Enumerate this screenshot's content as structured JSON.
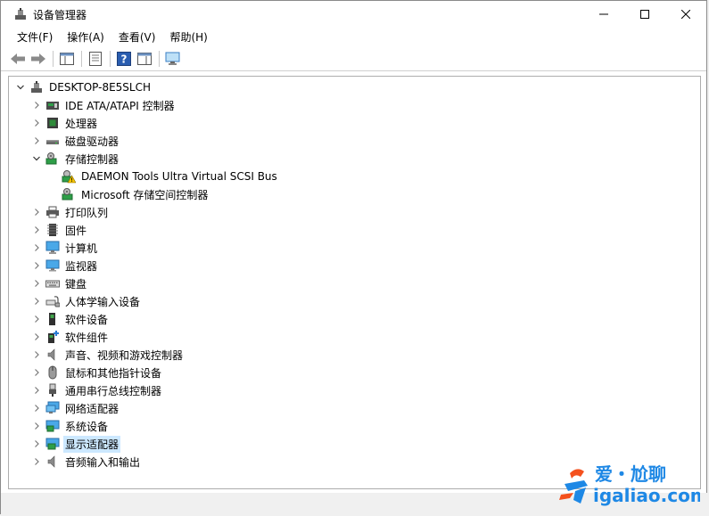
{
  "window": {
    "title": "设备管理器",
    "minimize_label": "",
    "maximize_label": "",
    "close_label": ""
  },
  "menu": [
    {
      "label": "文件(F)"
    },
    {
      "label": "操作(A)"
    },
    {
      "label": "查看(V)"
    },
    {
      "label": "帮助(H)"
    }
  ],
  "toolbar": {
    "buttons": [
      "back-arrow-icon",
      "forward-arrow-icon",
      "show-hide-tree-icon",
      "properties-icon",
      "help-icon",
      "action-pane-icon",
      "monitor-scan-icon"
    ]
  },
  "tree": {
    "root": "DESKTOP-8E5SLCH",
    "items": [
      {
        "label": "IDE ATA/ATAPI 控制器",
        "icon": "ide-controller-icon"
      },
      {
        "label": "处理器",
        "icon": "processor-icon"
      },
      {
        "label": "磁盘驱动器",
        "icon": "disk-drive-icon"
      },
      {
        "label": "存储控制器",
        "icon": "storage-controller-icon",
        "expanded": true
      },
      {
        "label": "DAEMON Tools Ultra Virtual SCSI Bus",
        "icon": "warning-storage-icon",
        "child": true
      },
      {
        "label": "Microsoft 存储空间控制器",
        "icon": "storage-controller-icon",
        "child": true
      },
      {
        "label": "打印队列",
        "icon": "printer-icon"
      },
      {
        "label": "固件",
        "icon": "firmware-icon"
      },
      {
        "label": "计算机",
        "icon": "computer-icon"
      },
      {
        "label": "监视器",
        "icon": "monitor-icon"
      },
      {
        "label": "键盘",
        "icon": "keyboard-icon"
      },
      {
        "label": "人体学输入设备",
        "icon": "hid-icon"
      },
      {
        "label": "软件设备",
        "icon": "software-device-icon"
      },
      {
        "label": "软件组件",
        "icon": "software-component-icon"
      },
      {
        "label": "声音、视频和游戏控制器",
        "icon": "speaker-icon"
      },
      {
        "label": "鼠标和其他指针设备",
        "icon": "mouse-icon"
      },
      {
        "label": "通用串行总线控制器",
        "icon": "usb-icon"
      },
      {
        "label": "网络适配器",
        "icon": "network-adapter-icon"
      },
      {
        "label": "系统设备",
        "icon": "system-device-icon"
      },
      {
        "label": "显示适配器",
        "icon": "display-adapter-icon",
        "selected": true
      },
      {
        "label": "音频输入和输出",
        "icon": "audio-io-icon"
      }
    ]
  },
  "watermark": {
    "brand": "爱・尬聊",
    "url": "igaliao.com"
  },
  "colors": {
    "selection": "#cce8ff",
    "watermark_blue": "#1e88e5",
    "watermark_orange": "#f4511e"
  }
}
